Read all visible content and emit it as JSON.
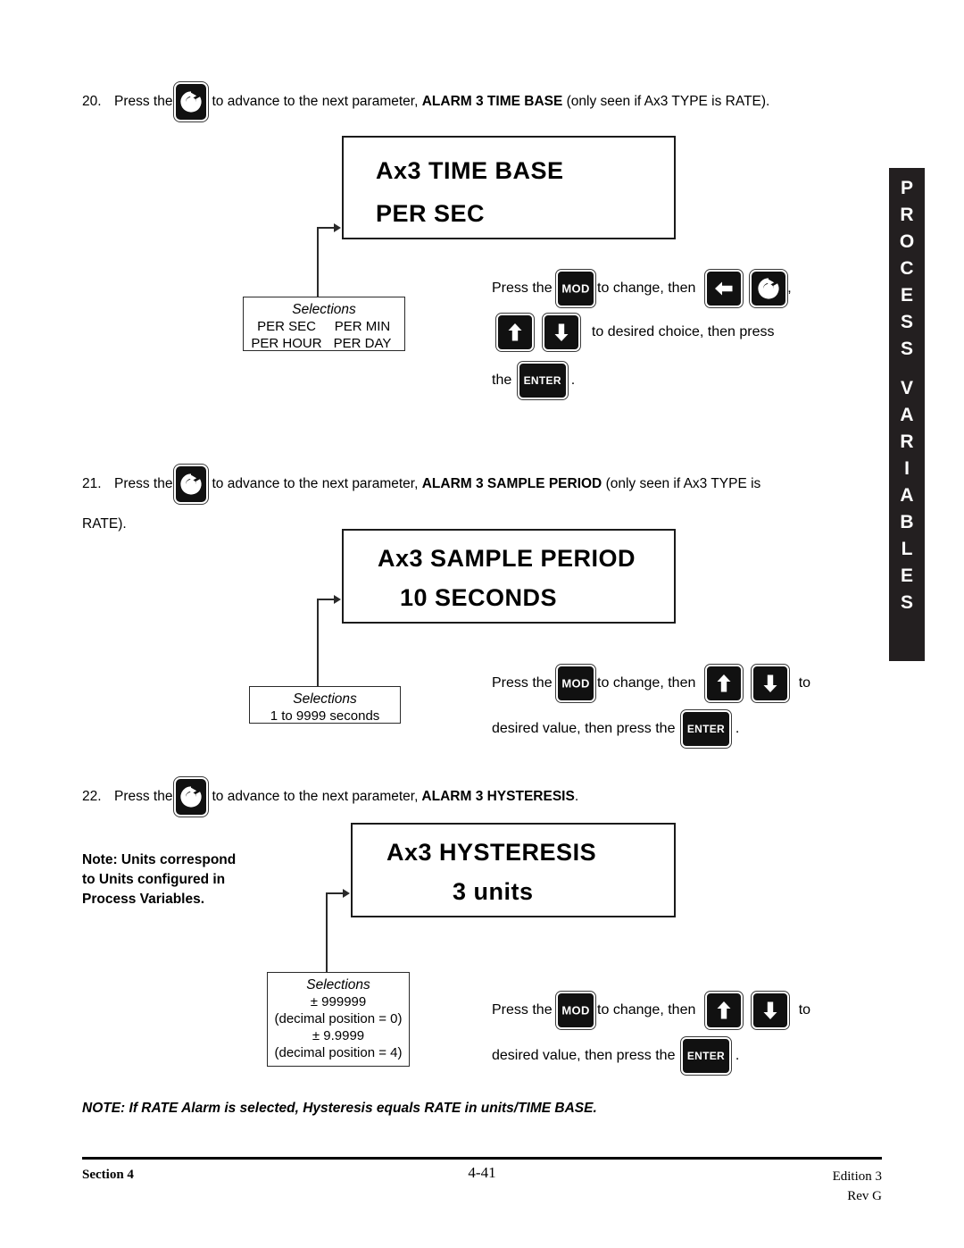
{
  "steps": [
    {
      "number": "20.",
      "text_before": "Press the",
      "text_mid": "to advance to the next parameter,",
      "param": "ALARM 3 TIME BASE",
      "text_after": "(only seen if Ax3 TYPE  is RATE)."
    },
    {
      "number": "21.",
      "text_before": "Press the",
      "text_mid": "to advance to the next parameter,",
      "param": "ALARM 3 SAMPLE PERIOD",
      "text_after": "(only seen if Ax3 TYPE  is",
      "text_after2": "RATE)."
    },
    {
      "number": "22.",
      "text_before": "Press the",
      "text_mid": "to advance to the next parameter,",
      "param": "ALARM 3 HYSTERESIS",
      "text_after": "."
    }
  ],
  "displays": [
    {
      "line1": "Ax3 TIME BASE",
      "line2": "PER SEC"
    },
    {
      "line1": "Ax3 SAMPLE PERIOD",
      "line2": "10 SECONDS"
    },
    {
      "line1": "Ax3 HYSTERESIS",
      "line2": "3 units"
    }
  ],
  "selections": [
    {
      "title": "Selections",
      "rows": [
        {
          "c1": "PER SEC",
          "c2": "PER MIN"
        },
        {
          "c1": "PER HOUR",
          "c2": "PER DAY"
        }
      ]
    },
    {
      "title": "Selections",
      "lines": [
        "1 to 9999 seconds"
      ]
    },
    {
      "title": "Selections",
      "lines": [
        "± 999999",
        "(decimal position = 0)",
        "± 9.9999",
        "(decimal position = 4)"
      ]
    }
  ],
  "instructions": {
    "block1": {
      "l1_a": "Press the",
      "l1_b": "to change, then",
      "l1_c": ",",
      "l2_a": "to desired choice, then press",
      "l3_a": "the",
      "l3_b": "."
    },
    "block2": {
      "l1_a": "Press the",
      "l1_b": "to change, then",
      "l1_c": "to",
      "l2_a": "desired value, then press the",
      "l2_b": "."
    },
    "block3": {
      "l1_a": "Press the",
      "l1_b": "to change, then",
      "l1_c": "to",
      "l2_a": "desired value, then press the",
      "l2_b": "."
    }
  },
  "keys": {
    "mod_label": "MOD",
    "enter_label": "ENTER",
    "loop_name": "advance-loop-key",
    "up_name": "up-arrow-key",
    "down_name": "down-arrow-key",
    "left_name": "left-arrow-key"
  },
  "note_left": {
    "line1": "Note: Units correspond",
    "line2": "to Units configured in",
    "line3": "Process Variables."
  },
  "note_bottom": "NOTE:  If RATE Alarm is selected, Hysteresis equals RATE in units/TIME BASE.",
  "side_tab": {
    "word1": "PROCESS",
    "word2": "VARIABLES"
  },
  "footer": {
    "left": "Section 4",
    "center": "4-41",
    "right_line1": "Edition 3",
    "right_line2": "Rev G"
  }
}
